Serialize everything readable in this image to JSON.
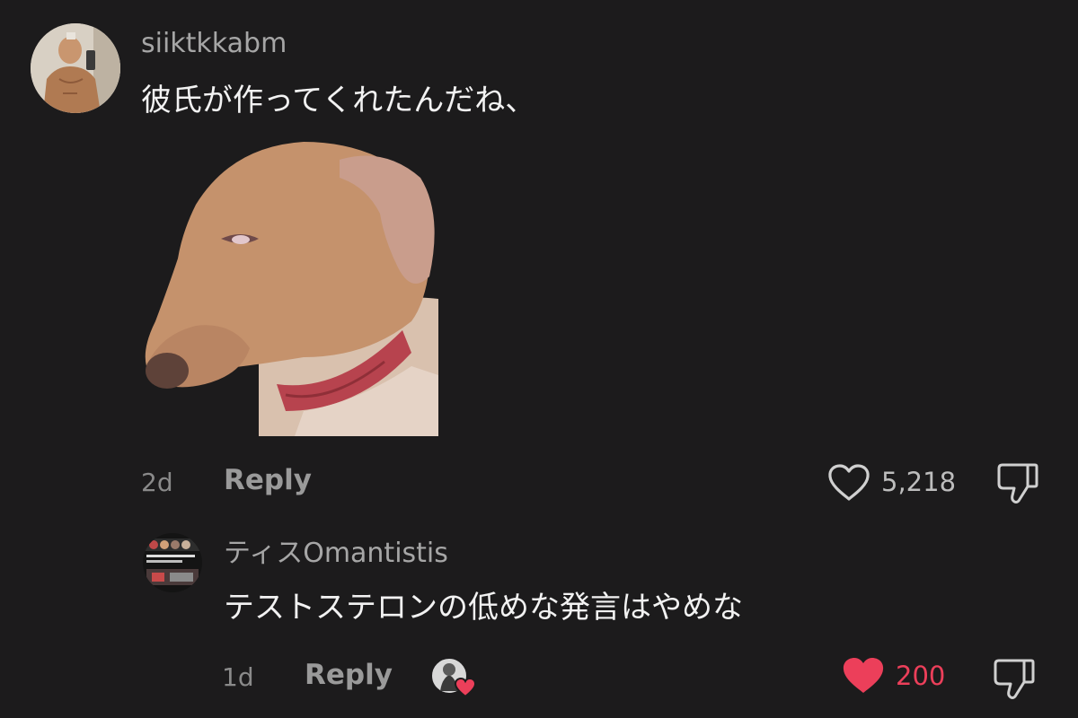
{
  "comments": [
    {
      "username": "siiktkkabm",
      "text": "彼氏が作ってくれたんだね、",
      "sticker": "dog-sticker",
      "time": "2d",
      "reply_label": "Reply",
      "like_count": "5,218",
      "liked": false
    },
    {
      "username": "ティスOmantistis",
      "text": "テストステロンの低めな発言はやめな",
      "time": "1d",
      "reply_label": "Reply",
      "like_count": "200",
      "liked": true,
      "creator_liked": true
    }
  ],
  "icons": {
    "like": "heart-outline-icon",
    "liked": "heart-filled-icon",
    "dislike": "thumbs-down-icon"
  },
  "colors": {
    "background": "#1c1b1c",
    "like_active": "#ec3f5a"
  }
}
